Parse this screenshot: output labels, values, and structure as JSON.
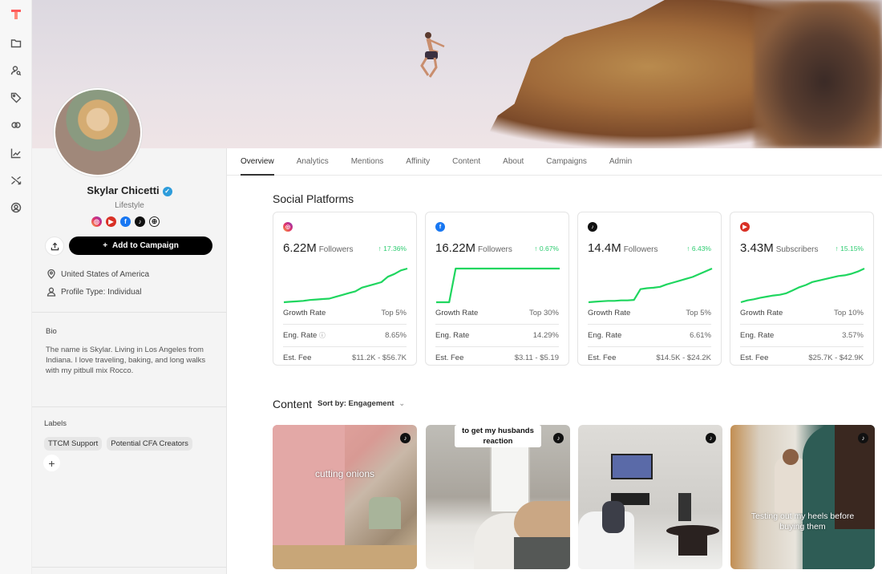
{
  "rail": {
    "logo": "T",
    "items": [
      {
        "icon": "folder-icon"
      },
      {
        "icon": "user-search-icon"
      },
      {
        "icon": "tag-icon"
      },
      {
        "icon": "link-icon"
      },
      {
        "icon": "chart-line-icon"
      },
      {
        "icon": "shuffle-icon"
      },
      {
        "icon": "user-circle-icon"
      }
    ]
  },
  "profile": {
    "name": "Skylar Chicetti",
    "verified": true,
    "category": "Lifestyle",
    "socials": [
      "instagram",
      "youtube",
      "facebook",
      "tiktok",
      "website"
    ],
    "add_to_campaign": "Add to Campaign",
    "add_icon": "+",
    "location": "United States of America",
    "profile_type": "Profile Type: Individual",
    "bio_heading": "Bio",
    "bio": "The name is Skylar. Living in Los Angeles from Indiana. I love traveling, baking, and long walks with my pitbull mix Rocco.",
    "labels_heading": "Labels",
    "labels": [
      "TTCM Support",
      "Potential CFA Creators"
    ],
    "add_label": "+"
  },
  "tabs": [
    {
      "label": "Overview",
      "active": true
    },
    {
      "label": "Analytics"
    },
    {
      "label": "Mentions"
    },
    {
      "label": "Affinity"
    },
    {
      "label": "Content"
    },
    {
      "label": "About"
    },
    {
      "label": "Campaigns"
    },
    {
      "label": "Admin"
    }
  ],
  "social_platforms": {
    "title": "Social Platforms",
    "row_labels": {
      "growth": "Growth Rate",
      "eng": "Eng. Rate",
      "fee": "Est. Fee"
    },
    "cards": [
      {
        "platform": "instagram",
        "color": "#e1306c",
        "count": "6.22M",
        "unit": "Followers",
        "change": "↑ 17.36%",
        "growth": "Top 5%",
        "eng": "8.65%",
        "eng_info": true,
        "fee": "$11.2K - $56.7K",
        "trend": [
          0,
          1,
          2,
          3,
          5,
          6,
          7,
          8,
          12,
          16,
          20,
          24,
          32,
          36,
          40,
          44,
          56,
          62,
          70,
          74
        ]
      },
      {
        "platform": "facebook",
        "color": "#1877f2",
        "count": "16.22M",
        "unit": "Followers",
        "change": "↑ 0.67%",
        "growth": "Top 30%",
        "eng": "14.29%",
        "eng_info": false,
        "fee": "$3.11 - $5.19",
        "trend": [
          0,
          0,
          0,
          100,
          100,
          100,
          100,
          100,
          100,
          100,
          100,
          100,
          100,
          100,
          100,
          100,
          100,
          100,
          100,
          100
        ]
      },
      {
        "platform": "tiktok",
        "color": "#111111",
        "count": "14.4M",
        "unit": "Followers",
        "change": "↑ 6.43%",
        "growth": "Top 5%",
        "eng": "6.61%",
        "eng_info": false,
        "fee": "$14.5K - $24.2K",
        "trend": [
          0,
          1,
          2,
          3,
          3,
          4,
          4,
          5,
          28,
          30,
          31,
          33,
          38,
          42,
          46,
          50,
          54,
          60,
          66,
          72
        ]
      },
      {
        "platform": "youtube",
        "color": "#d93025",
        "count": "3.43M",
        "unit": "Subscribers",
        "change": "↑ 15.15%",
        "growth": "Top 10%",
        "eng": "3.57%",
        "eng_info": false,
        "fee": "$25.7K - $42.9K",
        "trend": [
          0,
          5,
          8,
          12,
          15,
          18,
          20,
          24,
          32,
          40,
          46,
          54,
          58,
          62,
          66,
          70,
          72,
          76,
          82,
          90
        ]
      }
    ]
  },
  "content": {
    "title": "Content",
    "sort_label": "Sort by: Engagement",
    "items": [
      {
        "platform": "tiktok",
        "caption": "cutting onions"
      },
      {
        "platform": "tiktok",
        "caption": "to get my husbands reaction"
      },
      {
        "platform": "tiktok",
        "caption": ""
      },
      {
        "platform": "tiktok",
        "caption": "Testing out my heels before buying them"
      }
    ]
  }
}
